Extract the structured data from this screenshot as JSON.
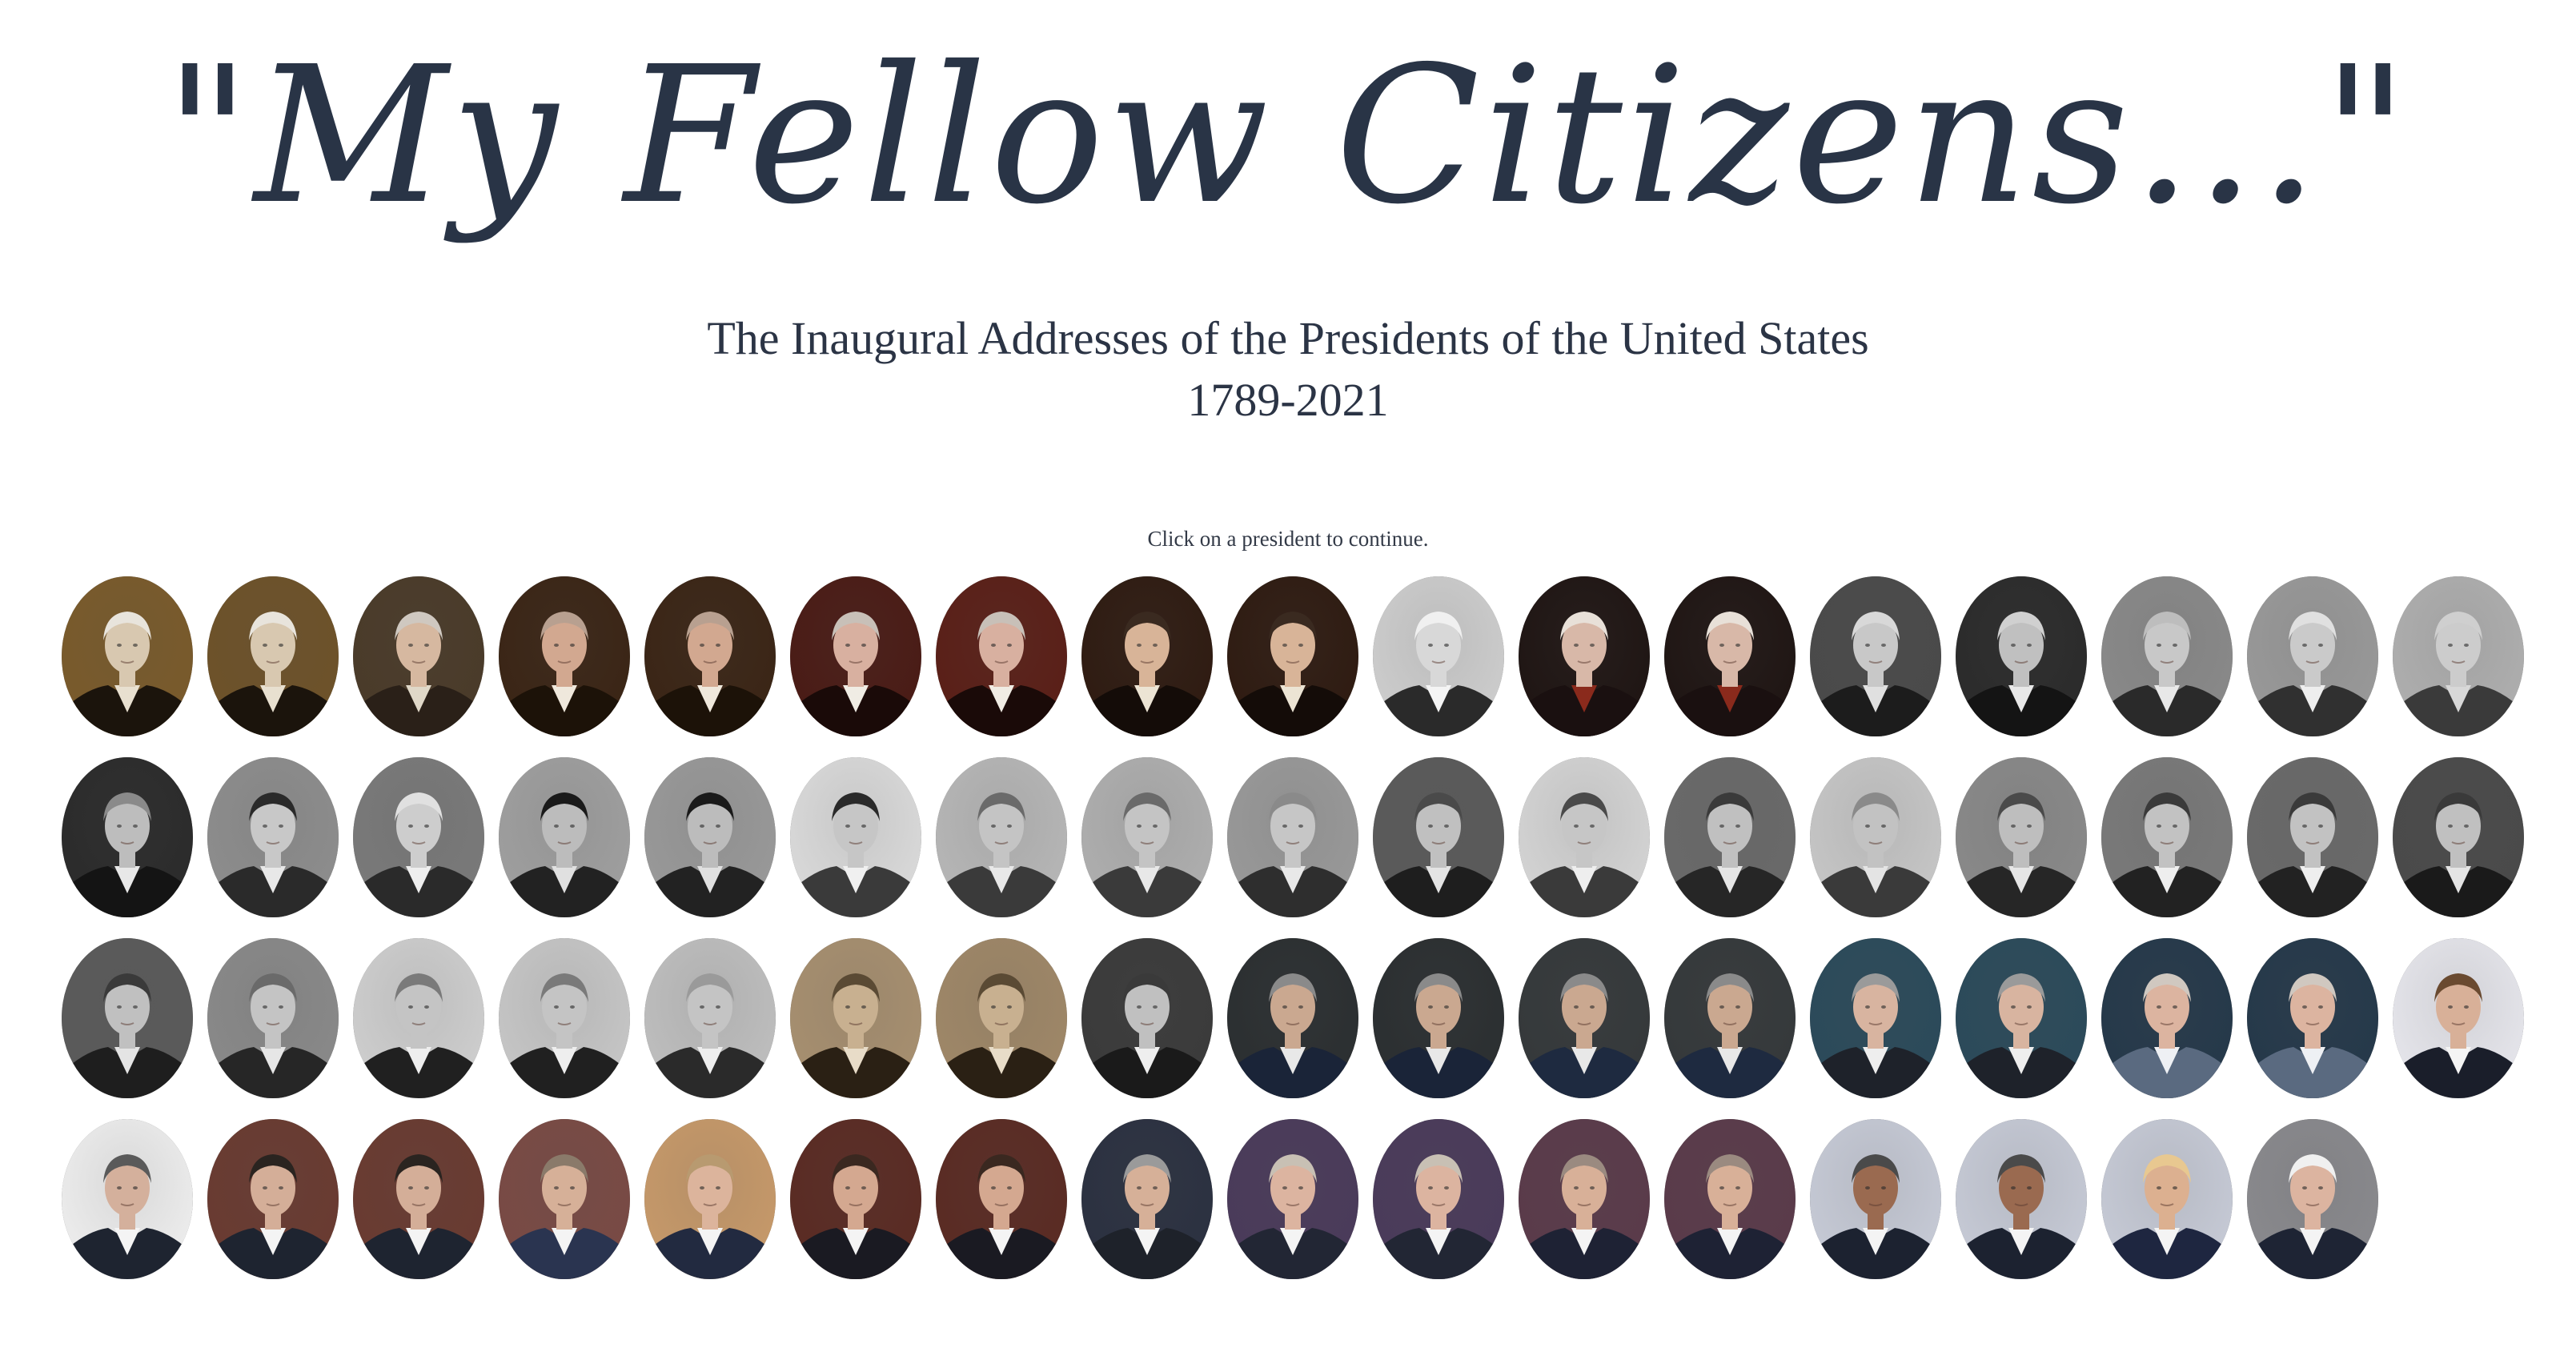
{
  "header": {
    "title": "\"My Fellow Citizens...\"",
    "subtitle": "The Inaugural Addresses of the Presidents of the United States",
    "years": "1789-2021",
    "hint": "Click on a president to continue."
  },
  "portraits": [
    {
      "bg": "#7a5a2a",
      "suit": "#1b140c",
      "face": "#d8c8b0",
      "hair": "#e8e4dc",
      "shirt": "#e8e0d0"
    },
    {
      "bg": "#6e5228",
      "suit": "#1b140c",
      "face": "#d8c8b0",
      "hair": "#e8e4dc",
      "shirt": "#e8e0d0"
    },
    {
      "bg": "#4a3a28",
      "suit": "#2a2018",
      "face": "#d6b8a0",
      "hair": "#cfc8c0",
      "shirt": "#e0d8c8"
    },
    {
      "bg": "#3a2414",
      "suit": "#1c1208",
      "face": "#d2a890",
      "hair": "#b8a090",
      "shirt": "#efe8dc"
    },
    {
      "bg": "#3a2414",
      "suit": "#1c1208",
      "face": "#d2a890",
      "hair": "#b8a090",
      "shirt": "#efe8dc"
    },
    {
      "bg": "#4a1a14",
      "suit": "#1a0a08",
      "face": "#d8b0a0",
      "hair": "#c8c0b8",
      "shirt": "#f0ece4"
    },
    {
      "bg": "#5a1e16",
      "suit": "#1a0a08",
      "face": "#d8b0a0",
      "hair": "#c8c0b8",
      "shirt": "#f0ece4"
    },
    {
      "bg": "#2e1a10",
      "suit": "#140c08",
      "face": "#d8b498",
      "hair": "#3a2a20",
      "shirt": "#ece4d4"
    },
    {
      "bg": "#2e1a10",
      "suit": "#140c08",
      "face": "#d8b498",
      "hair": "#3a2a20",
      "shirt": "#ece4d4"
    },
    {
      "bg": "#cfcfcf",
      "suit": "#2a2a2a",
      "face": "#d8d8d8",
      "hair": "#f0f0f0",
      "shirt": "#f4f4f4"
    },
    {
      "bg": "#1e1412",
      "suit": "#1a1010",
      "face": "#d8b8a8",
      "hair": "#e8e0d8",
      "shirt": "#8a2a1c"
    },
    {
      "bg": "#1e1412",
      "suit": "#1a1010",
      "face": "#d8b8a8",
      "hair": "#e8e0d8",
      "shirt": "#8a2a1c"
    },
    {
      "bg": "#4a4a4a",
      "suit": "#1c1c1c",
      "face": "#c8c8c8",
      "hair": "#d8d8d8",
      "shirt": "#e0e0e0"
    },
    {
      "bg": "#2a2a2a",
      "suit": "#141414",
      "face": "#c0c0c0",
      "hair": "#d0d0d0",
      "shirt": "#e8e8e8"
    },
    {
      "bg": "#8a8a8a",
      "suit": "#2a2a2a",
      "face": "#c8c8c8",
      "hair": "#bdbdbd",
      "shirt": "#e8e8e8"
    },
    {
      "bg": "#9a9a9a",
      "suit": "#303030",
      "face": "#cacaca",
      "hair": "#e0e0e0",
      "shirt": "#eeeeee"
    },
    {
      "bg": "#b0b0b0",
      "suit": "#3a3a3a",
      "face": "#cccccc",
      "hair": "#cfcfcf",
      "shirt": "#d8d8d8"
    },
    {
      "bg": "#2a2a2a",
      "suit": "#141414",
      "face": "#bdbdbd",
      "hair": "#8a8a8a",
      "shirt": "#e8e8e8"
    },
    {
      "bg": "#8e8e8e",
      "suit": "#2a2a2a",
      "face": "#c8c8c8",
      "hair": "#2a2a2a",
      "shirt": "#e8e8e8"
    },
    {
      "bg": "#7a7a7a",
      "suit": "#2a2a2a",
      "face": "#cdcdcd",
      "hair": "#e0e0e0",
      "shirt": "#eeeeee"
    },
    {
      "bg": "#a0a0a0",
      "suit": "#222222",
      "face": "#bcbcbc",
      "hair": "#1a1a1a",
      "shirt": "#e0e0e0"
    },
    {
      "bg": "#9a9a9a",
      "suit": "#222222",
      "face": "#bcbcbc",
      "hair": "#1a1a1a",
      "shirt": "#e0e0e0"
    },
    {
      "bg": "#dcdcdc",
      "suit": "#3a3a3a",
      "face": "#c6c6c6",
      "hair": "#2a2a2a",
      "shirt": "#f0f0f0"
    },
    {
      "bg": "#b8b8b8",
      "suit": "#3a3a3a",
      "face": "#c4c4c4",
      "hair": "#6a6a6a",
      "shirt": "#e8e8e8"
    },
    {
      "bg": "#b0b0b0",
      "suit": "#3a3a3a",
      "face": "#c4c4c4",
      "hair": "#6a6a6a",
      "shirt": "#e8e8e8"
    },
    {
      "bg": "#9a9a9a",
      "suit": "#2e2e2e",
      "face": "#c6c6c6",
      "hair": "#8a8a8a",
      "shirt": "#e8e8e8"
    },
    {
      "bg": "#5a5a5a",
      "suit": "#1e1e1e",
      "face": "#c0c0c0",
      "hair": "#4a4a4a",
      "shirt": "#e4e4e4"
    },
    {
      "bg": "#d6d6d6",
      "suit": "#3a3a3a",
      "face": "#c6c6c6",
      "hair": "#4a4a4a",
      "shirt": "#eeeeee"
    },
    {
      "bg": "#6a6a6a",
      "suit": "#262626",
      "face": "#c0c0c0",
      "hair": "#3a3a3a",
      "shirt": "#e6e6e6"
    },
    {
      "bg": "#c8c8c8",
      "suit": "#3a3a3a",
      "face": "#c2c2c2",
      "hair": "#8a8a8a",
      "shirt": "#e4e4e4"
    },
    {
      "bg": "#8a8a8a",
      "suit": "#262626",
      "face": "#bebebe",
      "hair": "#4a4a4a",
      "shirt": "#e6e6e6"
    },
    {
      "bg": "#7a7a7a",
      "suit": "#222222",
      "face": "#c2c2c2",
      "hair": "#3a3a3a",
      "shirt": "#eeeeee"
    },
    {
      "bg": "#6a6a6a",
      "suit": "#222222",
      "face": "#c2c2c2",
      "hair": "#3a3a3a",
      "shirt": "#eeeeee"
    },
    {
      "bg": "#4a4a4a",
      "suit": "#1a1a1a",
      "face": "#c0c0c0",
      "hair": "#3a3a3a",
      "shirt": "#e4e4e4"
    },
    {
      "bg": "#5a5a5a",
      "suit": "#1e1e1e",
      "face": "#c0c0c0",
      "hair": "#3a3a3a",
      "shirt": "#e4e4e4"
    },
    {
      "bg": "#8a8a8a",
      "suit": "#262626",
      "face": "#c4c4c4",
      "hair": "#6a6a6a",
      "shirt": "#e6e6e6"
    },
    {
      "bg": "#d0d0d0",
      "suit": "#202020",
      "face": "#c4c4c4",
      "hair": "#7a7a7a",
      "shirt": "#eeeeee"
    },
    {
      "bg": "#c8c8c8",
      "suit": "#202020",
      "face": "#c4c4c4",
      "hair": "#7a7a7a",
      "shirt": "#eeeeee"
    },
    {
      "bg": "#c0c0c0",
      "suit": "#2a2a2a",
      "face": "#c4c4c4",
      "hair": "#9a9a9a",
      "shirt": "#eeeeee"
    },
    {
      "bg": "#a89070",
      "suit": "#2a2014",
      "face": "#c8b090",
      "hair": "#5a4a34",
      "shirt": "#e8dcc8"
    },
    {
      "bg": "#a08868",
      "suit": "#2a2014",
      "face": "#c8b090",
      "hair": "#5a4a34",
      "shirt": "#e8dcc8"
    },
    {
      "bg": "#3a3a3a",
      "suit": "#1a1a1a",
      "face": "#c0c0c0",
      "hair": "#3a3a3a",
      "shirt": "#eeeeee"
    },
    {
      "bg": "#2a2e30",
      "suit": "#1a2438",
      "face": "#caa890",
      "hair": "#8a8a8a",
      "shirt": "#e8e8e8"
    },
    {
      "bg": "#2a2e30",
      "suit": "#1a2438",
      "face": "#caa890",
      "hair": "#8a8a8a",
      "shirt": "#e8e8e8"
    },
    {
      "bg": "#34383a",
      "suit": "#1e2a40",
      "face": "#caa890",
      "hair": "#8a8a8a",
      "shirt": "#e8e8e8"
    },
    {
      "bg": "#34383a",
      "suit": "#1e2a40",
      "face": "#caa890",
      "hair": "#8a8a8a",
      "shirt": "#e8e8e8"
    },
    {
      "bg": "#2a4a5a",
      "suit": "#1e222a",
      "face": "#d8b4a0",
      "hair": "#9a9a9a",
      "shirt": "#eeeeee"
    },
    {
      "bg": "#2a4a5a",
      "suit": "#1e222a",
      "face": "#d8b4a0",
      "hair": "#9a9a9a",
      "shirt": "#eeeeee"
    },
    {
      "bg": "#24384a",
      "suit": "#5a6a80",
      "face": "#dcb4a0",
      "hair": "#d0c8c0",
      "shirt": "#eef0f4"
    },
    {
      "bg": "#24384a",
      "suit": "#5a6a80",
      "face": "#dcb4a0",
      "hair": "#d0c8c0",
      "shirt": "#eef0f4"
    },
    {
      "bg": "#e8e8ee",
      "suit": "#1a1e2a",
      "face": "#d8b098",
      "hair": "#6a4a30",
      "shirt": "#f4f4f4"
    },
    {
      "bg": "#f0f0f0",
      "suit": "#1e2430",
      "face": "#d4b09c",
      "hair": "#5a5a5a",
      "shirt": "#f4f4f4"
    },
    {
      "bg": "#6a3a30",
      "suit": "#1e2430",
      "face": "#d4ae98",
      "hair": "#2a2420",
      "shirt": "#f4f4f4"
    },
    {
      "bg": "#6a3a30",
      "suit": "#1e2430",
      "face": "#d4ae98",
      "hair": "#2a2420",
      "shirt": "#f4f4f4"
    },
    {
      "bg": "#7a4a44",
      "suit": "#2a3450",
      "face": "#d6b098",
      "hair": "#8a7a6a",
      "shirt": "#f4f4f4"
    },
    {
      "bg": "#c89a6a",
      "suit": "#222a40",
      "face": "#dcb49c",
      "hair": "#b89a70",
      "shirt": "#f4f4f4"
    },
    {
      "bg": "#5a2a22",
      "suit": "#1a1a22",
      "face": "#d4a890",
      "hair": "#3a2820",
      "shirt": "#f4f4f4"
    },
    {
      "bg": "#5a2a22",
      "suit": "#1a1a22",
      "face": "#d4a890",
      "hair": "#3a2820",
      "shirt": "#f4f4f4"
    },
    {
      "bg": "#2a3040",
      "suit": "#1e222a",
      "face": "#d6b098",
      "hair": "#9a9a9a",
      "shirt": "#f4f4f4"
    },
    {
      "bg": "#4a3a5a",
      "suit": "#222634",
      "face": "#dcb4a0",
      "hair": "#c8c0b4",
      "shirt": "#f4f4f4"
    },
    {
      "bg": "#4a3a5a",
      "suit": "#222634",
      "face": "#dcb4a0",
      "hair": "#c8c0b4",
      "shirt": "#f4f4f4"
    },
    {
      "bg": "#5a3a4a",
      "suit": "#1e2234",
      "face": "#d8b098",
      "hair": "#9a8a80",
      "shirt": "#f4f4f4"
    },
    {
      "bg": "#5a3a4a",
      "suit": "#1e2234",
      "face": "#d8b098",
      "hair": "#9a8a80",
      "shirt": "#f4f4f4"
    },
    {
      "bg": "#c8ccd8",
      "suit": "#1c2230",
      "face": "#9a6a50",
      "hair": "#4a4a4a",
      "shirt": "#f4f4f4"
    },
    {
      "bg": "#c8ccd8",
      "suit": "#1c2230",
      "face": "#9a6a50",
      "hair": "#4a4a4a",
      "shirt": "#f4f4f4"
    },
    {
      "bg": "#c8ccd8",
      "suit": "#1e2640",
      "face": "#dcb090",
      "hair": "#e8c890",
      "shirt": "#f4f4f4"
    },
    {
      "bg": "#8a8a8e",
      "suit": "#1e2434",
      "face": "#dcb4a0",
      "hair": "#f0f0f0",
      "shirt": "#f4f4f4"
    }
  ]
}
